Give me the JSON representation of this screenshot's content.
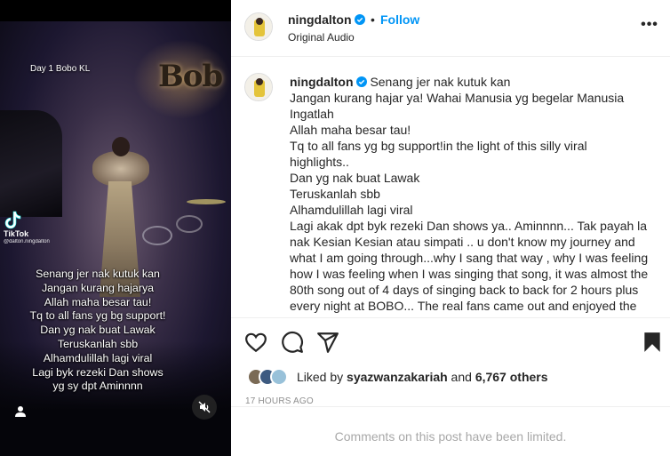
{
  "media": {
    "day_label": "Day 1 Bobo KL",
    "tiktok_name": "TikTok",
    "tiktok_handle": "@dalton.ningdalton",
    "caption_lines": [
      "Senang jer nak kutuk kan",
      "Jangan kurang hajarya",
      "Allah maha besar tau!",
      "Tq to all fans yg bg support!",
      "Dan yg nak buat Lawak",
      "Teruskanlah sbb",
      "Alhamdulillah lagi viral",
      "Lagi byk rezeki Dan shows",
      "yg sy dpt Aminnnn"
    ],
    "icons": {
      "user": "user-icon",
      "mute": "mute-icon"
    }
  },
  "header": {
    "username": "ningdalton",
    "separator": "•",
    "follow_label": "Follow",
    "subtitle": "Original Audio",
    "more_label": "•••"
  },
  "comment": {
    "username": "ningdalton",
    "first_line_text": "Senang jer nak kutuk kan",
    "lines": [
      "Jangan kurang hajar ya! Wahai Manusia yg begelar Manusia",
      "Ingatlah",
      "Allah maha besar tau!",
      "Tq to all fans yg bg support!in the light of this silly viral",
      "highlights..",
      "Dan yg nak buat Lawak",
      "Teruskanlah sbb",
      "Alhamdulillah lagi viral",
      "Lagi akak dpt byk rezeki Dan shows ya.. Aminnnn... Tak payah la",
      "nak Kesian Kesian atau simpati .. u don't know my journey and",
      "what I am going through...why I sang that way , why I was feeling",
      "how I was feeling when I was singing that song, it was almost the",
      "80th song out of 4 days of singing back to back for 2 hours plus",
      "every night at BOBO... The real fans came out and enjoyed the"
    ]
  },
  "actions": {
    "likes_prefix": "Liked by ",
    "liked_by_user": "syazwanzakariah",
    "likes_and": " and ",
    "likes_count": "6,767 others",
    "timestamp": "17 HOURS AGO"
  },
  "footer": {
    "limited_text": "Comments on this post have been limited."
  },
  "colors": {
    "accent": "#0095f6",
    "verified": "#0095f6",
    "muted": "#8e8e8e"
  }
}
